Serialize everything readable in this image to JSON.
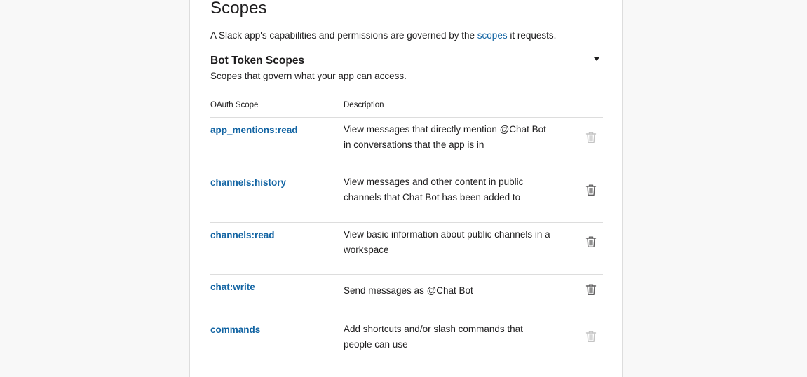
{
  "page": {
    "title": "Scopes",
    "intro_before": "A Slack app's capabilities and permissions are governed by the ",
    "intro_link": "scopes",
    "intro_after": " it requests."
  },
  "bot_scopes": {
    "title": "Bot Token Scopes",
    "subtitle": "Scopes that govern what your app can access.",
    "columns": {
      "scope": "OAuth Scope",
      "description": "Description"
    },
    "rows": [
      {
        "scope": "app_mentions:read",
        "description": "View messages that directly mention @Chat Bot in conversations that the app is in",
        "trash_state": "disabled"
      },
      {
        "scope": "channels:history",
        "description": "View messages and other content in public channels that Chat Bot has been added to",
        "trash_state": "enabled"
      },
      {
        "scope": "channels:read",
        "description": "View basic information about public channels in a workspace",
        "trash_state": "enabled"
      },
      {
        "scope": "chat:write",
        "description": "Send messages as @Chat Bot",
        "trash_state": "enabled"
      },
      {
        "scope": "commands",
        "description": "Add shortcuts and/or slash commands that people can use",
        "trash_state": "disabled"
      }
    ]
  },
  "colors": {
    "link": "#1264a3",
    "text": "#1d1c1d",
    "trash_enabled": "#616061",
    "trash_disabled": "#c4c4c4",
    "background": "#f8f8f8",
    "card": "#ffffff"
  },
  "icons": {
    "collapse": "caret-down-icon",
    "remove": "trash-icon"
  }
}
